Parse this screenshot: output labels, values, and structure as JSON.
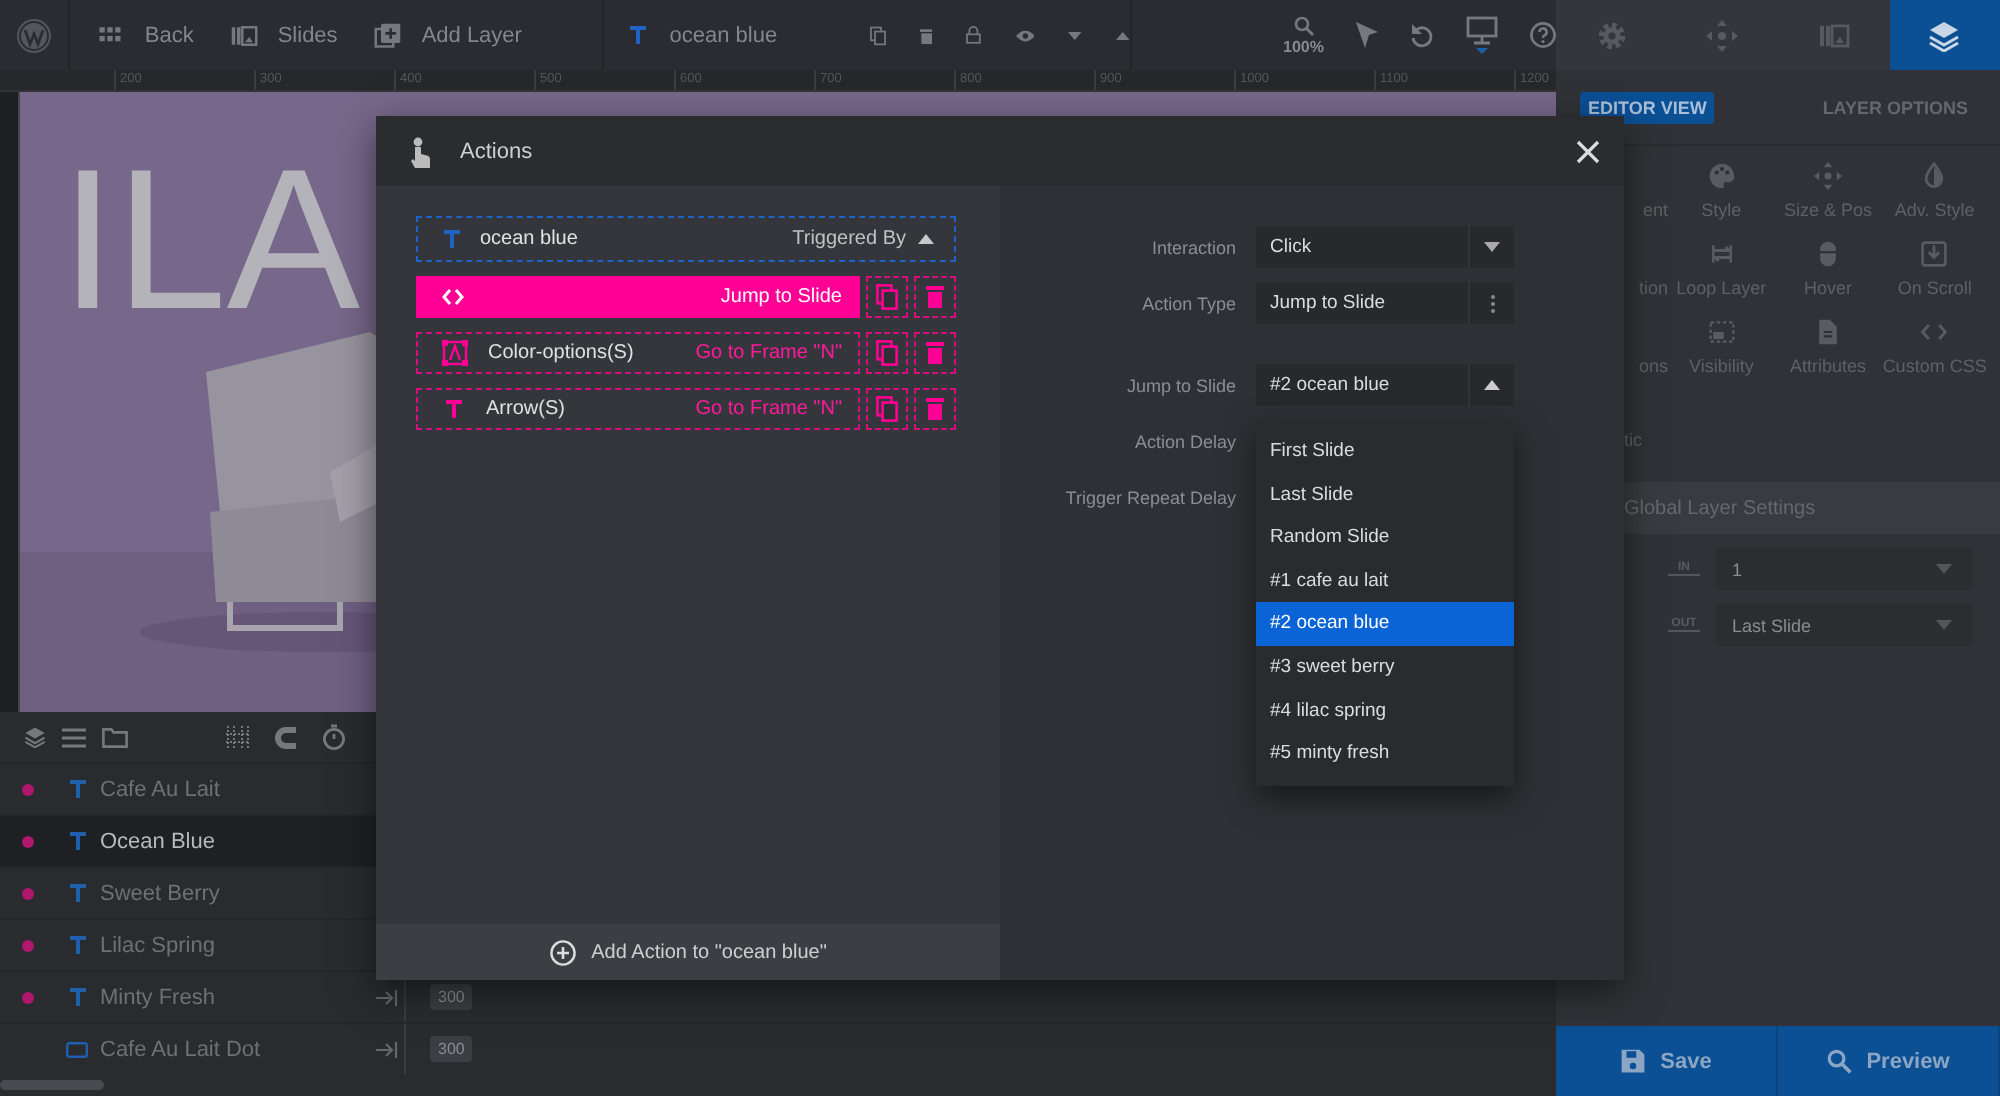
{
  "top_bar": {
    "nav": [
      {
        "kind": "grid",
        "label": "Back"
      },
      {
        "kind": "slides",
        "label": "Slides"
      },
      {
        "kind": "add",
        "label": "Add Layer"
      }
    ],
    "layer_name": "ocean blue",
    "zoom": "100%"
  },
  "ruler": {
    "ticks": [
      "200",
      "300",
      "400",
      "500",
      "600",
      "700",
      "800",
      "900",
      "1000",
      "1100",
      "1200"
    ]
  },
  "canvas": {
    "slide_text": "ILA"
  },
  "layers": {
    "items": [
      {
        "name": "Cafe Au Lait",
        "kind": "text",
        "flagged": true,
        "selected": false
      },
      {
        "name": "Ocean Blue",
        "kind": "text",
        "flagged": true,
        "selected": true
      },
      {
        "name": "Sweet Berry",
        "kind": "text",
        "flagged": true,
        "selected": false
      },
      {
        "name": "Lilac Spring",
        "kind": "text",
        "flagged": true,
        "selected": false
      },
      {
        "name": "Minty Fresh",
        "kind": "text",
        "flagged": true,
        "selected": false,
        "duration": "300"
      },
      {
        "name": "Cafe Au Lait Dot",
        "kind": "shape",
        "flagged": false,
        "selected": false,
        "duration": "300"
      }
    ]
  },
  "right_panel": {
    "tabs": [
      {
        "kind": "settings",
        "selected": false
      },
      {
        "kind": "move",
        "selected": false
      },
      {
        "kind": "slides",
        "selected": false
      },
      {
        "kind": "layers",
        "selected": true
      }
    ],
    "views": [
      {
        "label": "EDITOR VIEW",
        "selected": true
      },
      {
        "label": "LAYER OPTIONS",
        "selected": false
      }
    ],
    "options": [
      {
        "label": "ent",
        "kind": "partial"
      },
      {
        "label": "Style",
        "kind": "palette"
      },
      {
        "label": "Size & Pos",
        "kind": "move"
      },
      {
        "label": "Adv. Style",
        "kind": "drop"
      },
      {
        "label": "tion",
        "kind": "partial"
      },
      {
        "label": "Loop Layer",
        "kind": "loop"
      },
      {
        "label": "Hover",
        "kind": "mouse"
      },
      {
        "label": "On Scroll",
        "kind": "scroll"
      },
      {
        "label": "ons",
        "kind": "partial"
      },
      {
        "label": "Visibility",
        "kind": "visibility"
      },
      {
        "label": "Attributes",
        "kind": "document"
      },
      {
        "label": "Custom CSS",
        "kind": "code"
      }
    ],
    "static_label": "tic",
    "global_settings": {
      "title": "Global Layer Settings",
      "rows": [
        {
          "tag": "IN",
          "value": "1"
        },
        {
          "tag": "OUT",
          "value": "Last Slide"
        }
      ]
    },
    "buttons": [
      {
        "kind": "save",
        "label": "Save"
      },
      {
        "kind": "preview",
        "label": "Preview"
      }
    ]
  },
  "modal": {
    "title": "Actions",
    "trigger": {
      "layer": "ocean blue",
      "label": "Triggered By"
    },
    "actions": [
      {
        "kind": "code",
        "action": "Jump to Slide",
        "selected": true
      },
      {
        "kind": "group",
        "target": "Color-options(S)",
        "action": "Go to Frame \"N\"",
        "selected": false
      },
      {
        "kind": "text",
        "target": "Arrow(S)",
        "action": "Go to Frame \"N\"",
        "selected": false
      }
    ],
    "add_action": "Add Action to \"ocean blue\"",
    "fields": [
      {
        "label": "Interaction",
        "value": "Click",
        "kind": "select",
        "expanded": false
      },
      {
        "label": "Action Type",
        "value": "Jump to Slide",
        "kind": "menu"
      },
      {
        "label": "Jump to Slide",
        "value": "#2 ocean blue",
        "kind": "select",
        "expanded": true,
        "options": [
          {
            "label": "First Slide",
            "selected": false
          },
          {
            "label": "Last Slide",
            "selected": false
          },
          {
            "label": "Random Slide",
            "selected": false
          },
          {
            "label": "#1 cafe au lait",
            "selected": false
          },
          {
            "label": "#2 ocean blue",
            "selected": true
          },
          {
            "label": "#3 sweet berry",
            "selected": false
          },
          {
            "label": "#4 lilac spring",
            "selected": false
          },
          {
            "label": "#5 minty fresh",
            "selected": false
          }
        ]
      },
      {
        "label": "Action Delay"
      },
      {
        "label": "Trigger Repeat Delay"
      }
    ]
  }
}
